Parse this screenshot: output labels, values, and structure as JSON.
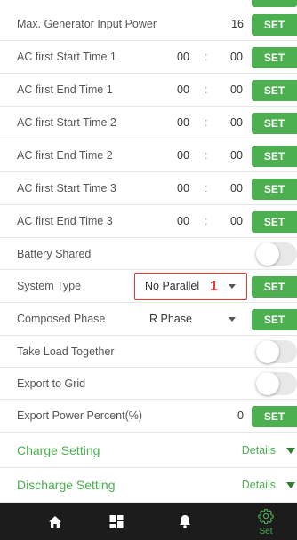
{
  "colors": {
    "accent": "#4caf50",
    "highlight": "#e53935",
    "navbar": "#1c1c1c"
  },
  "rows": [
    {
      "label": "Max. Generator Input Power",
      "value": "16",
      "button": "SET"
    },
    {
      "label": "AC first Start Time 1",
      "hour": "00",
      "sep": ":",
      "minute": "00",
      "button": "SET"
    },
    {
      "label": "AC first End Time 1",
      "hour": "00",
      "sep": ":",
      "minute": "00",
      "button": "SET"
    },
    {
      "label": "AC first Start Time 2",
      "hour": "00",
      "sep": ":",
      "minute": "00",
      "button": "SET"
    },
    {
      "label": "AC first End Time 2",
      "hour": "00",
      "sep": ":",
      "minute": "00",
      "button": "SET"
    },
    {
      "label": "AC first Start Time 3",
      "hour": "00",
      "sep": ":",
      "minute": "00",
      "button": "SET"
    },
    {
      "label": "AC first End Time 3",
      "hour": "00",
      "sep": ":",
      "minute": "00",
      "button": "SET"
    },
    {
      "label": "Battery Shared",
      "toggle": false
    },
    {
      "label": "System Type",
      "selected": "No Parallel",
      "marker": "1",
      "button": "SET"
    },
    {
      "label": "Composed Phase",
      "selected": "R Phase",
      "button": "SET"
    },
    {
      "label": "Take Load Together",
      "toggle": false
    },
    {
      "label": "Export to Grid",
      "toggle": false
    },
    {
      "label": "Export Power Percent(%)",
      "value": "0",
      "button": "SET"
    }
  ],
  "sections": [
    {
      "title": "Charge Setting",
      "details": "Details"
    },
    {
      "title": "Discharge Setting",
      "details": "Details"
    }
  ],
  "nav": [
    {
      "icon": "home-icon"
    },
    {
      "icon": "dashboard-icon"
    },
    {
      "icon": "bell-icon"
    },
    {
      "icon": "gear-icon",
      "label": "Set",
      "active": true
    }
  ]
}
